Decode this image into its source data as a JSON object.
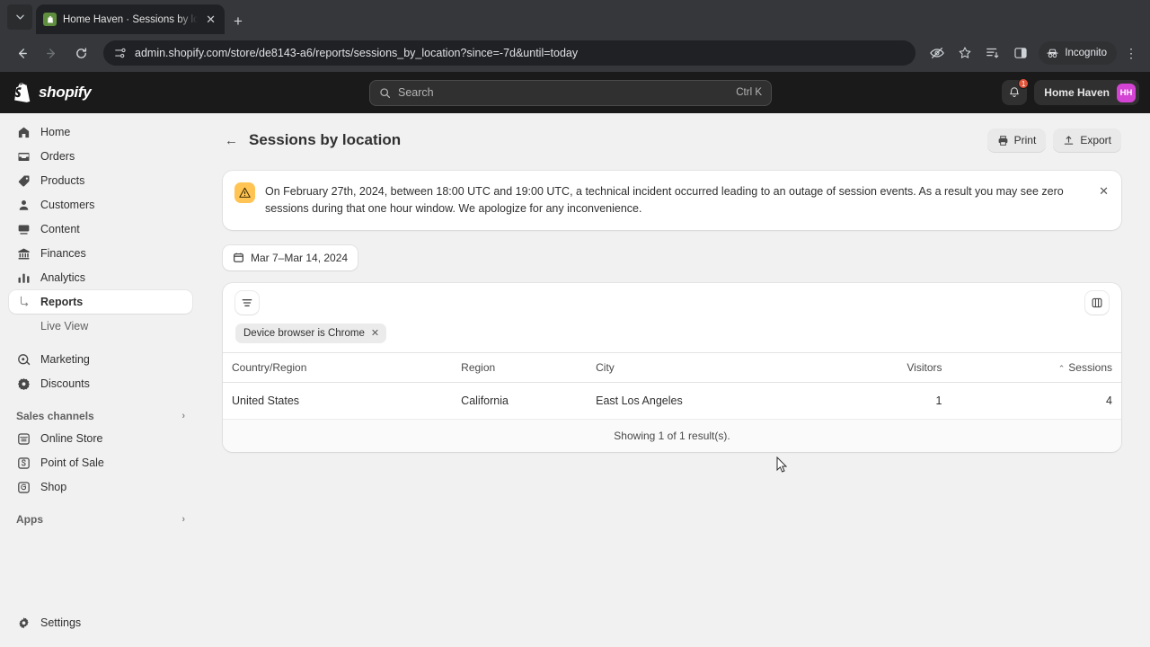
{
  "browser": {
    "tab": {
      "title": "Home Haven · Sessions by loca",
      "favicon": "shopify-bag-icon",
      "close": "✕"
    },
    "new_tab_label": "+",
    "tab_list_icon": "chevron-down-icon",
    "nav": {
      "back": "←",
      "forward": "→",
      "reload": "⟳"
    },
    "url": "admin.shopify.com/store/de8143-a6/reports/sessions_by_location?since=-7d&until=today",
    "site_info_icon": "page-settings-icon",
    "actions": {
      "tracking_protection": "eye-off-icon",
      "bookmark": "star-icon",
      "split_view": "split-screen-icon",
      "side_panel": "side-panel-icon",
      "incognito_label": "Incognito",
      "menu": "three-dot-menu-icon"
    }
  },
  "topbar": {
    "brand": "shopify",
    "search": {
      "placeholder": "Search",
      "shortcut": "Ctrl K",
      "icon": "search-icon"
    },
    "notifications": {
      "icon": "bell-icon",
      "count": "1"
    },
    "store": {
      "name": "Home Haven",
      "initials": "HH",
      "avatar_color": "#d444d4"
    }
  },
  "sidebar": {
    "items": [
      {
        "label": "Home",
        "icon": "home-icon"
      },
      {
        "label": "Orders",
        "icon": "orders-icon"
      },
      {
        "label": "Products",
        "icon": "tag-icon"
      },
      {
        "label": "Customers",
        "icon": "person-icon"
      },
      {
        "label": "Content",
        "icon": "content-icon"
      },
      {
        "label": "Finances",
        "icon": "bank-icon"
      },
      {
        "label": "Analytics",
        "icon": "bar-chart-icon"
      }
    ],
    "analytics_children": [
      {
        "label": "Reports",
        "active": true
      },
      {
        "label": "Live View",
        "active": false
      }
    ],
    "items_secondary": [
      {
        "label": "Marketing",
        "icon": "megaphone-icon"
      },
      {
        "label": "Discounts",
        "icon": "discount-icon"
      }
    ],
    "sales_channels": {
      "title": "Sales channels",
      "chevron": "›",
      "items": [
        {
          "label": "Online Store",
          "icon": "storefront-icon"
        },
        {
          "label": "Point of Sale",
          "icon": "pos-icon"
        },
        {
          "label": "Shop",
          "icon": "shop-icon"
        }
      ]
    },
    "apps": {
      "title": "Apps",
      "chevron": "›"
    },
    "settings": {
      "label": "Settings",
      "icon": "gear-icon"
    }
  },
  "page": {
    "back_arrow": "←",
    "title": "Sessions by location",
    "print_label": "Print",
    "export_label": "Export",
    "banner": {
      "icon": "warning-triangle-icon",
      "text": "On February 27th, 2024, between 18:00 UTC and 19:00 UTC, a technical incident occurred leading to an outage of session events. As a result you may see zero sessions during that one hour window. We apologize for any inconvenience.",
      "close": "✕"
    },
    "date_range": "Mar 7–Mar 14, 2024",
    "date_icon": "calendar-icon",
    "filter_button_icon": "filter-icon",
    "columns_button_icon": "columns-icon",
    "filter_chips": [
      {
        "label": "Device browser is Chrome",
        "remove": "✕"
      }
    ],
    "table": {
      "columns": [
        {
          "label": "Country/Region",
          "align": "left",
          "sorted": false
        },
        {
          "label": "Region",
          "align": "left",
          "sorted": false
        },
        {
          "label": "City",
          "align": "left",
          "sorted": false
        },
        {
          "label": "Visitors",
          "align": "right",
          "sorted": false
        },
        {
          "label": "Sessions",
          "align": "right",
          "sorted": true,
          "sort_icon": "⌃"
        }
      ],
      "rows": [
        {
          "country": "United States",
          "region": "California",
          "city": "East Los Angeles",
          "visitors": "1",
          "sessions": "4"
        }
      ],
      "footer": "Showing 1 of 1 result(s)."
    }
  }
}
